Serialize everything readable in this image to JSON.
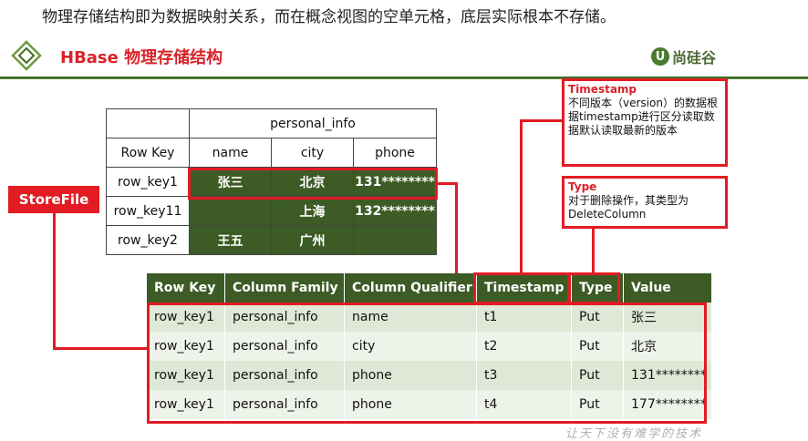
{
  "top_text": "物理存储结构即为数据映射关系，而在概念视图的空单元格，底层实际根本不存储。",
  "slide_title": "HBase 物理存储结构",
  "logo": {
    "mark": "U",
    "text": "尚硅谷"
  },
  "logical_table": {
    "family": "personal_info",
    "row_key_header": "Row Key",
    "columns": [
      "name",
      "city",
      "phone"
    ],
    "rows": [
      {
        "key": "row_key1",
        "cells": [
          "张三",
          "北京",
          "131********"
        ]
      },
      {
        "key": "row_key11",
        "cells": [
          "",
          "上海",
          "132********"
        ]
      },
      {
        "key": "row_key2",
        "cells": [
          "王五",
          "广州",
          ""
        ]
      }
    ]
  },
  "storefile_label": "StoreFile",
  "timestamp_note": {
    "title": "Timestamp",
    "body": "不同版本（version）的数据根据timestamp进行区分读取数据默认读取最新的版本"
  },
  "type_note": {
    "title": "Type",
    "body": "对于删除操作，其类型为DeleteColumn"
  },
  "storage_table": {
    "headers": [
      "Row Key",
      "Column Family",
      "Column Qualifier",
      "Timestamp",
      "Type",
      "Value"
    ],
    "rows": [
      [
        "row_key1",
        "personal_info",
        "name",
        "t1",
        "Put",
        "张三"
      ],
      [
        "row_key1",
        "personal_info",
        "city",
        "t2",
        "Put",
        "北京"
      ],
      [
        "row_key1",
        "personal_info",
        "phone",
        "t3",
        "Put",
        "131********"
      ],
      [
        "row_key1",
        "personal_info",
        "phone",
        "t4",
        "Put",
        "177********"
      ]
    ]
  },
  "watermark": "让天下没有难学的技术",
  "colors": {
    "accent_red": "#e31b23",
    "header_green": "#3d5b25",
    "row_green_light": "#dfe8d6"
  }
}
